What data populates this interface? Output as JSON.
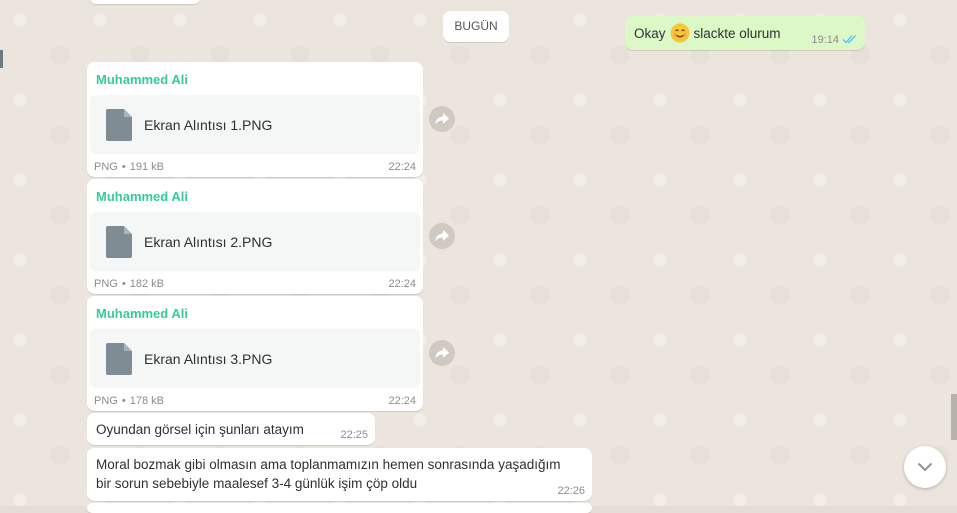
{
  "date_chip": "BUGÜN",
  "outgoing": {
    "text_before": "Okay",
    "emoji": "smiling-face-icon",
    "text_after": "slackte olurum",
    "time": "19:14",
    "status": "read"
  },
  "files": [
    {
      "sender": "Muhammed Ali",
      "name": "Ekran Alıntısı 1.PNG",
      "type": "PNG",
      "size": "191 kB",
      "time": "22:24"
    },
    {
      "sender": "Muhammed Ali",
      "name": "Ekran Alıntısı 2.PNG",
      "type": "PNG",
      "size": "182 kB",
      "time": "22:24"
    },
    {
      "sender": "Muhammed Ali",
      "name": "Ekran Alıntısı 3.PNG",
      "type": "PNG",
      "size": "178 kB",
      "time": "22:24"
    }
  ],
  "texts": [
    {
      "lines": [
        "Oyundan görsel için şunları atayım"
      ],
      "time": "22:25"
    },
    {
      "lines": [
        "Moral bozmak gibi olmasın ama toplanmamızın hemen sonrasında yaşadığım",
        "bir sorun sebebiyle maalesef 3-4 günlük işim çöp oldu"
      ],
      "time": "22:26"
    }
  ],
  "separator": "•",
  "colors": {
    "sender": "#35cd96",
    "outgoing_bg": "#dcf8c6",
    "read_ticks": "#4fc3f7"
  }
}
